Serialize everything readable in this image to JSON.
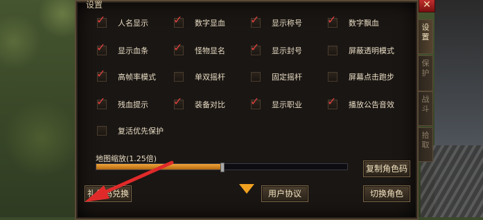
{
  "panel": {
    "title": "设置",
    "close_symbol": "✕"
  },
  "options": [
    {
      "label": "人名显示",
      "checked": true
    },
    {
      "label": "数字显血",
      "checked": true
    },
    {
      "label": "显示称号",
      "checked": true
    },
    {
      "label": "数字飘血",
      "checked": true
    },
    {
      "label": "显示血条",
      "checked": true
    },
    {
      "label": "怪物显名",
      "checked": true
    },
    {
      "label": "显示封号",
      "checked": true
    },
    {
      "label": "屏蔽透明模式",
      "checked": false
    },
    {
      "label": "高帧率模式",
      "checked": true
    },
    {
      "label": "单双摇杆",
      "checked": false
    },
    {
      "label": "固定摇杆",
      "checked": false
    },
    {
      "label": "屏幕点击跑步",
      "checked": false
    },
    {
      "label": "残血提示",
      "checked": true
    },
    {
      "label": "装备对比",
      "checked": true
    },
    {
      "label": "显示职业",
      "checked": true
    },
    {
      "label": "播放公告音效",
      "checked": true
    },
    {
      "label": "复活优先保护",
      "checked": false
    }
  ],
  "zoom": {
    "label": "地图缩放(1.25倍)",
    "fraction": 0.5
  },
  "buttons": {
    "copy_role": "复制角色码",
    "gift_code": "礼包码兑换",
    "user_agreement": "用户协议",
    "switch_role": "切换角色"
  },
  "tabs": [
    {
      "label": "设置",
      "active": true
    },
    {
      "label": "保护",
      "active": false
    },
    {
      "label": "战斗",
      "active": false
    },
    {
      "label": "拾取",
      "active": false
    }
  ],
  "colors": {
    "accent": "#f0a020",
    "check": "#e04040",
    "annotation": "#e02a2a"
  }
}
